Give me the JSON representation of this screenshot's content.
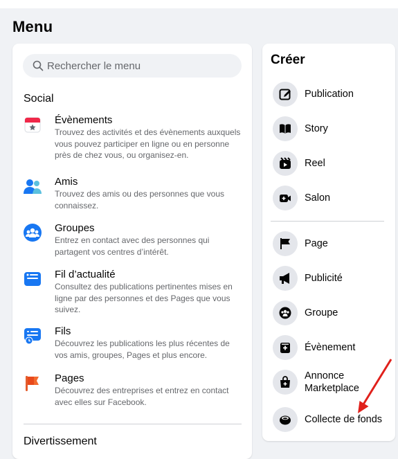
{
  "page": {
    "title": "Menu"
  },
  "search": {
    "placeholder": "Rechercher le menu"
  },
  "social": {
    "title": "Social",
    "items": [
      {
        "title": "Évènements",
        "desc": "Trouvez des activités et des évènements auxquels vous pouvez participer en ligne ou en personne près de chez vous, ou organisez-en.",
        "icon": "calendar-icon"
      },
      {
        "title": "Amis",
        "desc": "Trouvez des amis ou des personnes que vous connaissez.",
        "icon": "friends-icon"
      },
      {
        "title": "Groupes",
        "desc": "Entrez en contact avec des personnes qui partagent vos centres d’intérêt.",
        "icon": "groups-icon"
      },
      {
        "title": "Fil d’actualité",
        "desc": "Consultez des publications pertinentes mises en ligne par des personnes et des Pages que vous suivez.",
        "icon": "feed-icon"
      },
      {
        "title": "Fils",
        "desc": "Découvrez les publications les plus récentes de vos amis, groupes, Pages et plus encore.",
        "icon": "feeds-icon"
      },
      {
        "title": "Pages",
        "desc": "Découvrez des entreprises et entrez en contact avec elles sur Facebook.",
        "icon": "pages-flag-icon"
      }
    ]
  },
  "entertainment": {
    "title": "Divertissement"
  },
  "create": {
    "title": "Créer",
    "items": [
      {
        "label": "Publication",
        "icon": "edit-icon"
      },
      {
        "label": "Story",
        "icon": "book-icon"
      },
      {
        "label": "Reel",
        "icon": "reel-icon"
      },
      {
        "label": "Salon",
        "icon": "video-icon"
      },
      {
        "label": "Page",
        "icon": "flag-icon"
      },
      {
        "label": "Publicité",
        "icon": "megaphone-icon"
      },
      {
        "label": "Groupe",
        "icon": "group-icon"
      },
      {
        "label": "Évènement",
        "icon": "event-icon"
      },
      {
        "label": "Annonce Marketplace",
        "icon": "shopping-bag-icon"
      },
      {
        "label": "Collecte de fonds",
        "icon": "fundraiser-icon"
      }
    ]
  },
  "colors": {
    "background": "#f0f2f5",
    "accent": "#1877f2",
    "annotation_arrow": "#e0201b"
  }
}
